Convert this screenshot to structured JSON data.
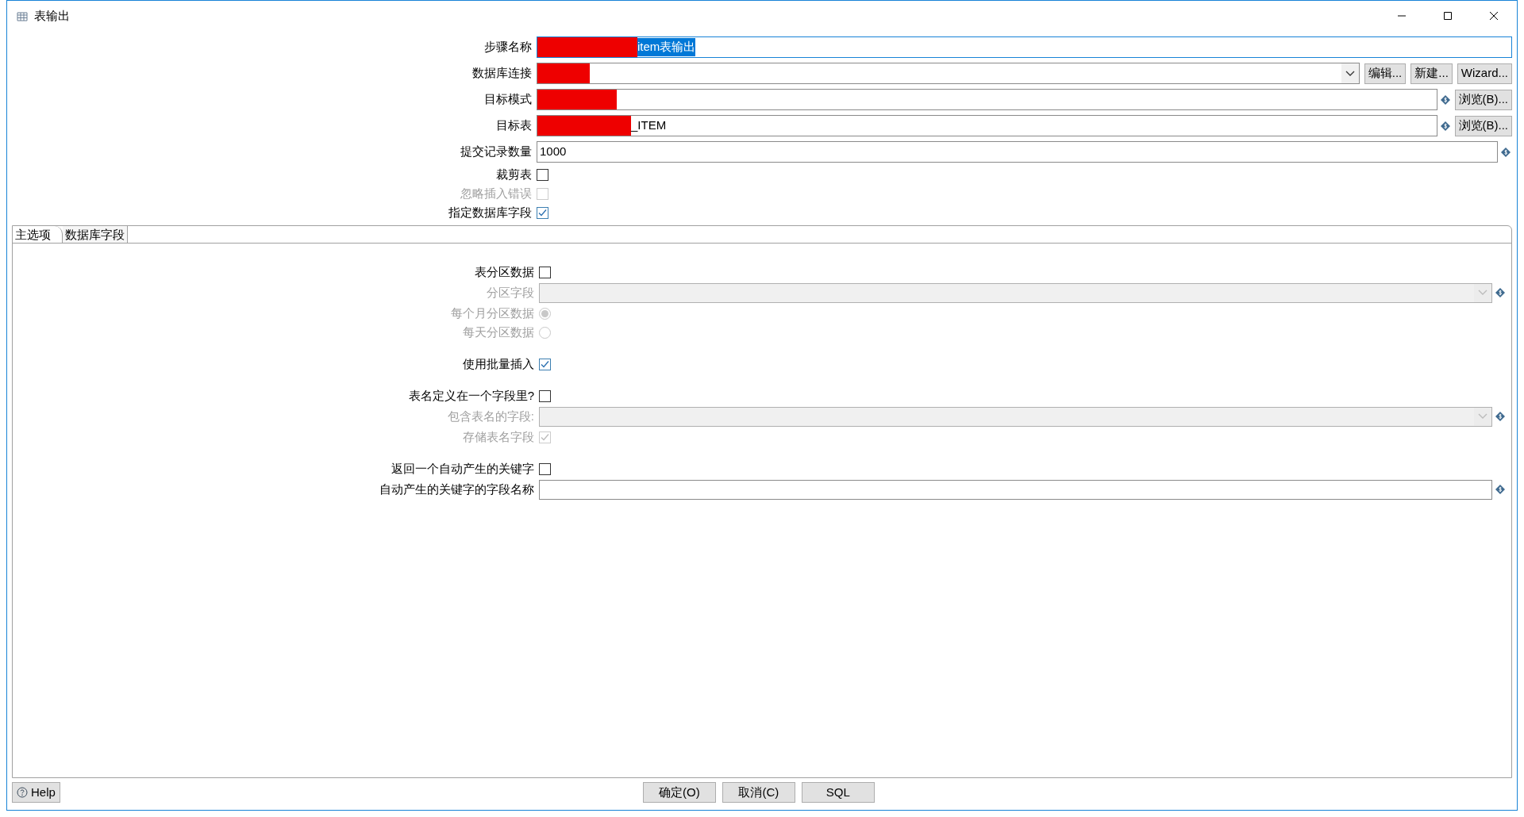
{
  "window": {
    "title": "表输出"
  },
  "fields": [
    {
      "kind": "text",
      "label": "步骤名称",
      "value": "item表输出",
      "redacted": true,
      "highlighted": true,
      "focused": true
    },
    {
      "kind": "combo",
      "label": "数据库连接",
      "redacted": true,
      "buttons": [
        "编辑...",
        "新建...",
        "Wizard..."
      ]
    },
    {
      "kind": "text",
      "label": "目标模式",
      "redacted": true,
      "variable": true,
      "buttons": [
        "浏览(B)..."
      ]
    },
    {
      "kind": "text",
      "label": "目标表",
      "value": "_ITEM",
      "redacted": true,
      "variable": true,
      "buttons": [
        "浏览(B)..."
      ]
    },
    {
      "kind": "text",
      "label": "提交记录数量",
      "value": "1000",
      "variable": true
    },
    {
      "kind": "checkbox",
      "label": "裁剪表",
      "checked": false,
      "disabled": false
    },
    {
      "kind": "checkbox",
      "label": "忽略插入错误",
      "checked": false,
      "disabled": true
    },
    {
      "kind": "checkbox",
      "label": "指定数据库字段",
      "checked": true,
      "disabled": false
    }
  ],
  "tabs": [
    {
      "label": "主选项",
      "selected": true
    },
    {
      "label": "数据库字段",
      "selected": false
    }
  ],
  "option_groups": [
    [
      {
        "kind": "checkbox",
        "label": "表分区数据",
        "checked": false,
        "disabled": false
      },
      {
        "kind": "combo",
        "label": "分区字段",
        "disabled": true,
        "variable": true
      },
      {
        "kind": "radio",
        "label": "每个月分区数据",
        "selected": true,
        "disabled": true
      },
      {
        "kind": "radio",
        "label": "每天分区数据",
        "selected": false,
        "disabled": true
      }
    ],
    [
      {
        "kind": "checkbox",
        "label": "使用批量插入",
        "checked": true,
        "disabled": false
      }
    ],
    [
      {
        "kind": "checkbox",
        "label": "表名定义在一个字段里?",
        "checked": false,
        "disabled": false
      },
      {
        "kind": "combo",
        "label": "包含表名的字段:",
        "disabled": true,
        "variable": true
      },
      {
        "kind": "checkbox",
        "label": "存储表名字段",
        "checked": true,
        "disabled": true
      }
    ],
    [
      {
        "kind": "checkbox",
        "label": "返回一个自动产生的关键字",
        "checked": false,
        "disabled": false
      },
      {
        "kind": "text",
        "label": "自动产生的关键字的字段名称",
        "disabled": false,
        "variable": true
      }
    ]
  ],
  "footer": {
    "help": "Help",
    "buttons": [
      "确定(O)",
      "取消(C)",
      "SQL"
    ]
  }
}
